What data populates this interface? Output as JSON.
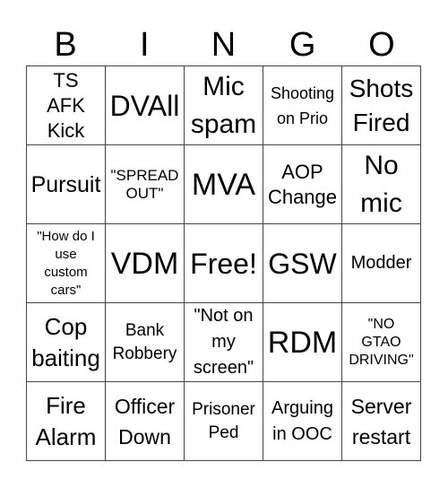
{
  "header": {
    "letters": [
      "B",
      "I",
      "N",
      "G",
      "O"
    ]
  },
  "cells": [
    "TS\nAFK\nKick",
    "DVAll",
    "Mic\nspam",
    "Shooting\non Prio",
    "Shots\nFired",
    "Pursuit",
    "\"SPREAD\nOUT\"",
    "MVA",
    "AOP\nChange",
    "No\nmic",
    "\"How do I\nuse\ncustom\ncars\"",
    "VDM",
    "Free!",
    "GSW",
    "Modder",
    "Cop\nbaiting",
    "Bank\nRobbery",
    "\"Not on\nmy\nscreen\"",
    "RDM",
    "\"NO\nGTAO\nDRIVING\"",
    "Fire\nAlarm",
    "Officer\nDown",
    "Prisoner\nPed",
    "Arguing\nin OOC",
    "Server\nrestart"
  ]
}
